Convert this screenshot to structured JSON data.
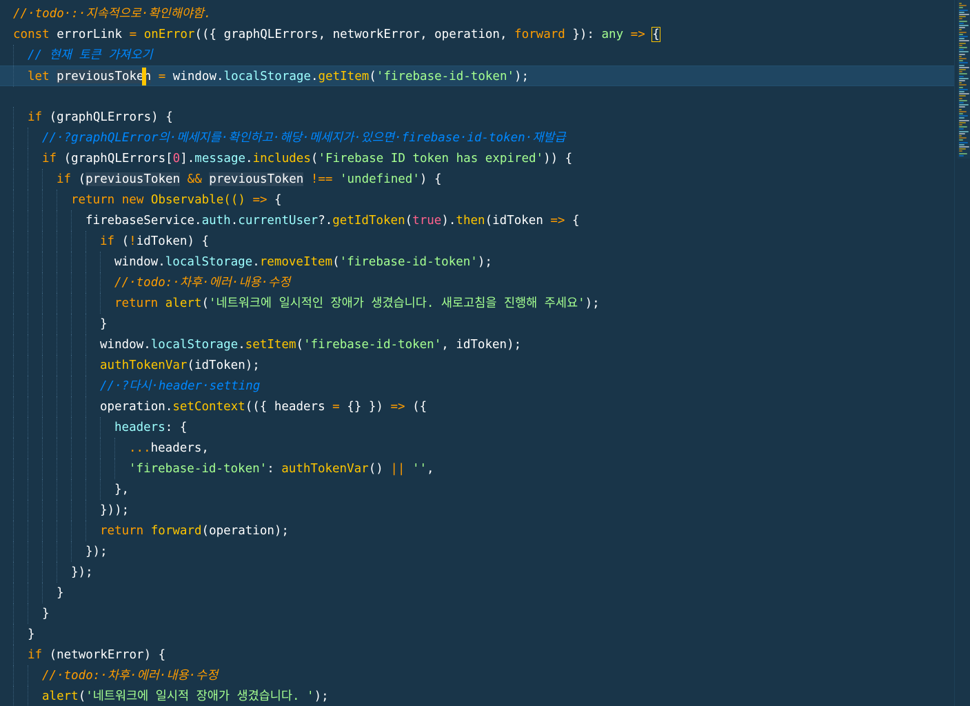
{
  "editor": {
    "colors": {
      "background": "#193549",
      "active_line": "#1f4662",
      "keyword": "#ff9d00",
      "function": "#ffc600",
      "string": "#a5ff90",
      "comment": "#0088ff",
      "property": "#9effff",
      "number": "#ff628c",
      "cursor": "#ffc600"
    },
    "lines": [
      {
        "indent": 0,
        "tokens": [
          {
            "c": "todo",
            "t": "//·todo·:·지속적으로·확인해야함."
          }
        ]
      },
      {
        "indent": 0,
        "tokens": [
          {
            "c": "kw",
            "t": "const"
          },
          {
            "c": "tx",
            "t": " errorLink "
          },
          {
            "c": "op",
            "t": "="
          },
          {
            "c": "tx",
            "t": " "
          },
          {
            "c": "fn",
            "t": "onError"
          },
          {
            "c": "tx",
            "t": "(({ graphQLErrors, networkError, operation, "
          },
          {
            "c": "kw",
            "t": "forward"
          },
          {
            "c": "tx",
            "t": " }): "
          },
          {
            "c": "str",
            "t": "any"
          },
          {
            "c": "tx",
            "t": " "
          },
          {
            "c": "op",
            "t": "=>"
          },
          {
            "c": "tx",
            "t": " "
          },
          {
            "c": "tx",
            "t": "{",
            "box": true
          }
        ]
      },
      {
        "indent": 1,
        "tokens": [
          {
            "c": "cm",
            "t": "// 현재 토큰 가져오기"
          }
        ]
      },
      {
        "indent": 1,
        "active": true,
        "tokens": [
          {
            "c": "kw",
            "t": "let"
          },
          {
            "c": "tx",
            "t": " "
          },
          {
            "c": "tx",
            "t": "previousToke",
            "hl": true
          },
          {
            "cursor": true
          },
          {
            "c": "tx",
            "t": "n",
            "hl": true
          },
          {
            "c": "tx",
            "t": " "
          },
          {
            "c": "op",
            "t": "="
          },
          {
            "c": "tx",
            "t": " window."
          },
          {
            "c": "prop",
            "t": "localStorage"
          },
          {
            "c": "tx",
            "t": "."
          },
          {
            "c": "fn",
            "t": "getItem"
          },
          {
            "c": "tx",
            "t": "("
          },
          {
            "c": "str",
            "t": "'firebase-id-token'"
          },
          {
            "c": "tx",
            "t": ");"
          }
        ]
      },
      {
        "indent": 0,
        "tokens": []
      },
      {
        "indent": 1,
        "tokens": [
          {
            "c": "kw",
            "t": "if"
          },
          {
            "c": "tx",
            "t": " (graphQLErrors) {"
          }
        ]
      },
      {
        "indent": 2,
        "tokens": [
          {
            "c": "cm",
            "t": "//·?graphQLError의·메세지를·확인하고·해당·메세지가·있으면·firebase·id-token·재발급"
          }
        ]
      },
      {
        "indent": 2,
        "tokens": [
          {
            "c": "kw",
            "t": "if"
          },
          {
            "c": "tx",
            "t": " (graphQLErrors["
          },
          {
            "c": "num",
            "t": "0"
          },
          {
            "c": "tx",
            "t": "]."
          },
          {
            "c": "prop",
            "t": "message"
          },
          {
            "c": "tx",
            "t": "."
          },
          {
            "c": "fn",
            "t": "includes"
          },
          {
            "c": "tx",
            "t": "("
          },
          {
            "c": "str",
            "t": "'Firebase ID token has expired'"
          },
          {
            "c": "tx",
            "t": ")) {"
          }
        ]
      },
      {
        "indent": 3,
        "tokens": [
          {
            "c": "kw",
            "t": "if"
          },
          {
            "c": "tx",
            "t": " ("
          },
          {
            "c": "tx",
            "t": "previousToken",
            "hl": true
          },
          {
            "c": "tx",
            "t": " "
          },
          {
            "c": "op",
            "t": "&&"
          },
          {
            "c": "tx",
            "t": " "
          },
          {
            "c": "tx",
            "t": "previousToken",
            "hl": true
          },
          {
            "c": "tx",
            "t": " "
          },
          {
            "c": "op",
            "t": "!=="
          },
          {
            "c": "tx",
            "t": " "
          },
          {
            "c": "str",
            "t": "'undefined'"
          },
          {
            "c": "tx",
            "t": ") {"
          }
        ]
      },
      {
        "indent": 4,
        "tokens": [
          {
            "c": "kw",
            "t": "return"
          },
          {
            "c": "tx",
            "t": " "
          },
          {
            "c": "kw",
            "t": "new"
          },
          {
            "c": "tx",
            "t": " "
          },
          {
            "c": "fn",
            "t": "Observable"
          },
          {
            "c": "fn",
            "t": "(()"
          },
          {
            "c": "tx",
            "t": " "
          },
          {
            "c": "op",
            "t": "=>"
          },
          {
            "c": "tx",
            "t": " {"
          }
        ]
      },
      {
        "indent": 5,
        "tokens": [
          {
            "c": "tx",
            "t": "firebaseService."
          },
          {
            "c": "prop",
            "t": "auth"
          },
          {
            "c": "tx",
            "t": "."
          },
          {
            "c": "prop",
            "t": "currentUser"
          },
          {
            "c": "tx",
            "t": "?."
          },
          {
            "c": "fn",
            "t": "getIdToken"
          },
          {
            "c": "tx",
            "t": "("
          },
          {
            "c": "num",
            "t": "true"
          },
          {
            "c": "tx",
            "t": ")."
          },
          {
            "c": "fn",
            "t": "then"
          },
          {
            "c": "tx",
            "t": "(idToken "
          },
          {
            "c": "op",
            "t": "=>"
          },
          {
            "c": "tx",
            "t": " {"
          }
        ]
      },
      {
        "indent": 6,
        "tokens": [
          {
            "c": "kw",
            "t": "if"
          },
          {
            "c": "tx",
            "t": " ("
          },
          {
            "c": "op",
            "t": "!"
          },
          {
            "c": "tx",
            "t": "idToken) {"
          }
        ]
      },
      {
        "indent": 7,
        "tokens": [
          {
            "c": "tx",
            "t": "window."
          },
          {
            "c": "prop",
            "t": "localStorage"
          },
          {
            "c": "tx",
            "t": "."
          },
          {
            "c": "fn",
            "t": "removeItem"
          },
          {
            "c": "tx",
            "t": "("
          },
          {
            "c": "str",
            "t": "'firebase-id-token'"
          },
          {
            "c": "tx",
            "t": ");"
          }
        ]
      },
      {
        "indent": 7,
        "tokens": [
          {
            "c": "todo",
            "t": "//·todo:·차후·에러·내용·수정"
          }
        ]
      },
      {
        "indent": 7,
        "tokens": [
          {
            "c": "kw",
            "t": "return"
          },
          {
            "c": "tx",
            "t": " "
          },
          {
            "c": "fn",
            "t": "alert"
          },
          {
            "c": "tx",
            "t": "("
          },
          {
            "c": "str",
            "t": "'네트워크에 일시적인 장애가 생겼습니다. 새로고침을 진행해 주세요'"
          },
          {
            "c": "tx",
            "t": ");"
          }
        ]
      },
      {
        "indent": 6,
        "tokens": [
          {
            "c": "tx",
            "t": "}"
          }
        ]
      },
      {
        "indent": 6,
        "tokens": [
          {
            "c": "tx",
            "t": "window."
          },
          {
            "c": "prop",
            "t": "localStorage"
          },
          {
            "c": "tx",
            "t": "."
          },
          {
            "c": "fn",
            "t": "setItem"
          },
          {
            "c": "tx",
            "t": "("
          },
          {
            "c": "str",
            "t": "'firebase-id-token'"
          },
          {
            "c": "tx",
            "t": ", idToken);"
          }
        ]
      },
      {
        "indent": 6,
        "tokens": [
          {
            "c": "fn",
            "t": "authTokenVar"
          },
          {
            "c": "tx",
            "t": "(idToken);"
          }
        ]
      },
      {
        "indent": 6,
        "tokens": [
          {
            "c": "cm",
            "t": "//·?다시·header·setting"
          }
        ]
      },
      {
        "indent": 6,
        "tokens": [
          {
            "c": "tx",
            "t": "operation."
          },
          {
            "c": "fn",
            "t": "setContext"
          },
          {
            "c": "tx",
            "t": "(({ headers "
          },
          {
            "c": "op",
            "t": "="
          },
          {
            "c": "tx",
            "t": " {} }) "
          },
          {
            "c": "op",
            "t": "=>"
          },
          {
            "c": "tx",
            "t": " ({"
          }
        ]
      },
      {
        "indent": 7,
        "tokens": [
          {
            "c": "prop",
            "t": "headers"
          },
          {
            "c": "tx",
            "t": ": {"
          }
        ]
      },
      {
        "indent": 8,
        "tokens": [
          {
            "c": "op",
            "t": "..."
          },
          {
            "c": "tx",
            "t": "headers,"
          }
        ]
      },
      {
        "indent": 8,
        "tokens": [
          {
            "c": "str",
            "t": "'firebase-id-token'"
          },
          {
            "c": "tx",
            "t": ": "
          },
          {
            "c": "fn",
            "t": "authTokenVar"
          },
          {
            "c": "tx",
            "t": "() "
          },
          {
            "c": "op",
            "t": "||"
          },
          {
            "c": "tx",
            "t": " "
          },
          {
            "c": "str",
            "t": "''"
          },
          {
            "c": "tx",
            "t": ","
          }
        ]
      },
      {
        "indent": 7,
        "tokens": [
          {
            "c": "tx",
            "t": "},"
          }
        ]
      },
      {
        "indent": 6,
        "tokens": [
          {
            "c": "tx",
            "t": "}));"
          }
        ]
      },
      {
        "indent": 6,
        "tokens": [
          {
            "c": "kw",
            "t": "return"
          },
          {
            "c": "tx",
            "t": " "
          },
          {
            "c": "fn",
            "t": "forward"
          },
          {
            "c": "tx",
            "t": "(operation);"
          }
        ]
      },
      {
        "indent": 5,
        "tokens": [
          {
            "c": "tx",
            "t": "});"
          }
        ]
      },
      {
        "indent": 4,
        "tokens": [
          {
            "c": "tx",
            "t": "});"
          }
        ]
      },
      {
        "indent": 3,
        "tokens": [
          {
            "c": "tx",
            "t": "}"
          }
        ]
      },
      {
        "indent": 2,
        "tokens": [
          {
            "c": "tx",
            "t": "}"
          }
        ]
      },
      {
        "indent": 1,
        "tokens": [
          {
            "c": "tx",
            "t": "}"
          }
        ]
      },
      {
        "indent": 1,
        "tokens": [
          {
            "c": "kw",
            "t": "if"
          },
          {
            "c": "tx",
            "t": " (networkError) {"
          }
        ]
      },
      {
        "indent": 2,
        "tokens": [
          {
            "c": "todo",
            "t": "//·todo:·차후·에러·내용·수정"
          }
        ]
      },
      {
        "indent": 2,
        "tokens": [
          {
            "c": "fn",
            "t": "alert"
          },
          {
            "c": "tx",
            "t": "("
          },
          {
            "c": "str",
            "t": "'네트워크에 일시적 장애가 생겼습니다. '"
          },
          {
            "c": "tx",
            "t": ");"
          }
        ]
      }
    ]
  }
}
